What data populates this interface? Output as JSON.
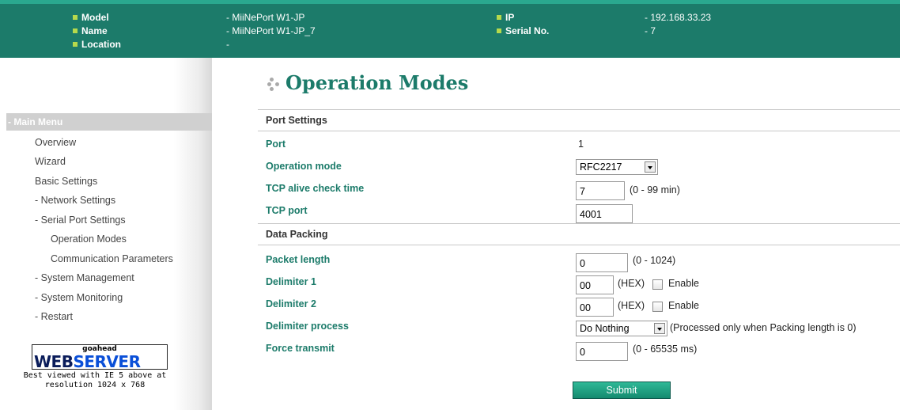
{
  "header": {
    "model_label": "Model",
    "model_value": "- MiiNePort W1-JP",
    "name_label": "Name",
    "name_value": "- MiiNePort W1-JP_7",
    "location_label": "Location",
    "location_value": "-",
    "ip_label": "IP",
    "ip_value": "- 192.168.33.23",
    "serial_label": "Serial No.",
    "serial_value": "- 7"
  },
  "sidebar": {
    "menu_title": "- Main Menu",
    "items": [
      "Overview",
      "Wizard",
      "Basic Settings",
      "- Network Settings",
      "- Serial Port Settings",
      "Operation Modes",
      "Communication Parameters",
      "- System Management",
      "- System Monitoring",
      "- Restart"
    ],
    "badge": {
      "top": "goahead",
      "web": "WEB",
      "server": "SERVER"
    },
    "note_line1": "Best viewed with IE 5 above at",
    "note_line2": "resolution 1024 x 768"
  },
  "main": {
    "title": "Operation Modes",
    "port_settings": "Port Settings",
    "port_label": "Port",
    "port_value": "1",
    "mode_label": "Operation mode",
    "mode_value": "RFC2217",
    "alive_label": "TCP alive check time",
    "alive_value": "7",
    "alive_hint": "(0 - 99 min)",
    "tcpport_label": "TCP port",
    "tcpport_value": "4001",
    "data_packing": "Data Packing",
    "packet_label": "Packet length",
    "packet_value": "0",
    "packet_hint": "(0 - 1024)",
    "d1_label": "Delimiter 1",
    "d1_value": "00",
    "d1_hex": "(HEX)",
    "d1_enable": "Enable",
    "d2_label": "Delimiter 2",
    "d2_value": "00",
    "d2_hex": "(HEX)",
    "d2_enable": "Enable",
    "dproc_label": "Delimiter process",
    "dproc_value": "Do Nothing",
    "dproc_hint": "(Processed only when Packing length is 0)",
    "force_label": "Force transmit",
    "force_value": "0",
    "force_hint": "(0 - 65535 ms)",
    "submit": "Submit"
  }
}
